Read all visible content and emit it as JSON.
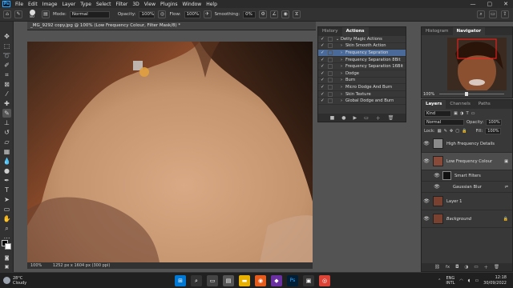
{
  "menubar": {
    "logo": "Ps",
    "items": [
      "File",
      "Edit",
      "Image",
      "Layer",
      "Type",
      "Select",
      "Filter",
      "3D",
      "View",
      "Plugins",
      "Window",
      "Help"
    ],
    "window_controls": [
      "—",
      "▢",
      "✕"
    ]
  },
  "options": {
    "brush_size": "80",
    "mode_label": "Mode:",
    "mode_value": "Normal",
    "opacity_label": "Opacity:",
    "opacity_value": "100%",
    "flow_label": "Flow:",
    "flow_value": "100%",
    "smoothing_label": "Smoothing:",
    "smoothing_value": "0%"
  },
  "document": {
    "tab_title": "_MG_9292 copy.jpg @ 100% (Low Frequency Colour, Filter Mask/8) *",
    "status_zoom": "100%",
    "status_size": "1252 px x 1604 px (300 ppi)"
  },
  "actions_panel": {
    "tabs": [
      "History",
      "Actions"
    ],
    "active_tab": "Actions",
    "items": [
      {
        "label": "Detty Magic Actions",
        "level": 0,
        "selected": false
      },
      {
        "label": "Skin Smooth Action",
        "level": 1,
        "selected": false
      },
      {
        "label": "Frequency Sepration",
        "level": 1,
        "selected": true
      },
      {
        "label": "Frequency Separation 8Bit",
        "level": 1,
        "selected": false
      },
      {
        "label": "Frequency Separation 16Bit",
        "level": 1,
        "selected": false
      },
      {
        "label": "Dodge",
        "level": 1,
        "selected": false
      },
      {
        "label": "Burn",
        "level": 1,
        "selected": false
      },
      {
        "label": "Micro Dodge And Burn",
        "level": 1,
        "selected": false
      },
      {
        "label": "Skin Texture",
        "level": 1,
        "selected": false
      },
      {
        "label": "Global Dodge and Burn",
        "level": 1,
        "selected": false
      }
    ]
  },
  "navigator_panel": {
    "tabs": [
      "Histogram",
      "Navigator"
    ],
    "active_tab": "Navigator",
    "zoom": "100%"
  },
  "layers_panel": {
    "tabs": [
      "Layers",
      "Channels",
      "Paths"
    ],
    "active_tab": "Layers",
    "filter_label": "Kind",
    "blend_mode": "Normal",
    "opacity_label": "Opacity:",
    "opacity_value": "100%",
    "lock_label": "Lock:",
    "fill_label": "Fill:",
    "fill_value": "100%",
    "layers": [
      {
        "name": "High Frequency Details",
        "thumb": "#8a8a8a",
        "selected": false,
        "mask": false,
        "italic": false
      },
      {
        "name": "Low Frequency Colour",
        "thumb": "#8a4a3a",
        "selected": true,
        "mask": true,
        "italic": false
      },
      {
        "name": "Smart Filters",
        "thumb": "",
        "selected": false,
        "mask": false,
        "italic": false,
        "sub": true
      },
      {
        "name": "Gaussian Blur",
        "thumb": "",
        "selected": false,
        "mask": false,
        "italic": false,
        "sub2": true
      },
      {
        "name": "Layer 1",
        "thumb": "#7a4030",
        "selected": false,
        "mask": false,
        "italic": false
      },
      {
        "name": "Background",
        "thumb": "#7a4030",
        "selected": false,
        "mask": false,
        "italic": true
      }
    ]
  },
  "taskbar": {
    "temp": "28°C",
    "weather": "Cloudy",
    "lang1": "ENG",
    "lang2": "INTL",
    "time": "12:18",
    "date": "30/09/2022"
  }
}
